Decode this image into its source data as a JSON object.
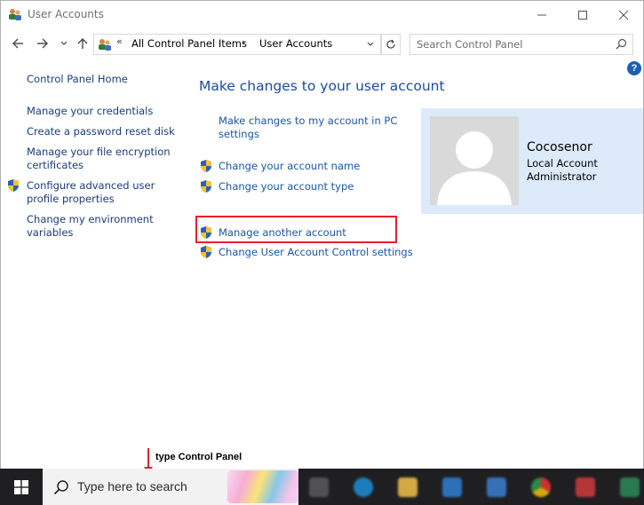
{
  "window": {
    "title": "User Accounts",
    "controls": [
      "minimize",
      "maximize",
      "close"
    ]
  },
  "address_bar": {
    "overflow": "«",
    "crumbs": [
      "All Control Panel Items",
      "User Accounts"
    ],
    "separator": "›"
  },
  "search": {
    "placeholder": "Search Control Panel"
  },
  "help_label": "?",
  "sidebar": {
    "items": [
      {
        "label": "Control Panel Home"
      },
      {
        "label": "Manage your credentials"
      },
      {
        "label": "Create a password reset disk"
      },
      {
        "label": "Manage your file encryption",
        "label2": "certificates"
      },
      {
        "label": "Configure advanced user",
        "label2": "profile properties",
        "icon": "uac-shield-icon"
      },
      {
        "label": "Change my environment",
        "label2": "variables"
      }
    ]
  },
  "main": {
    "heading": "Make changes to your user account",
    "links": [
      {
        "label": "Make changes to my account in PC",
        "label2": "settings"
      },
      {
        "label": "Change your account name",
        "icon": "uac-shield-icon"
      },
      {
        "label": "Change your account type",
        "icon": "uac-shield-icon"
      },
      {
        "label": "Manage another account",
        "icon": "uac-shield-icon",
        "highlighted": true
      },
      {
        "label": "Change User Account Control settings",
        "icon": "uac-shield-icon"
      }
    ]
  },
  "account": {
    "name": "Cocosenor",
    "type": "Local Account",
    "role": "Administrator"
  },
  "annotation": {
    "text": "type Control Panel"
  },
  "taskbar": {
    "search_placeholder": "Type here to search",
    "icons": [
      "start-icon",
      "task-view-icon",
      "edge-icon",
      "file-explorer-icon",
      "mail-icon",
      "store-icon",
      "chrome-icon",
      "app-icon"
    ]
  },
  "colors": {
    "link": "#1a3c7a",
    "heading": "#1e4aa6",
    "highlight": "#e8202a",
    "card": "#ddeaf9",
    "taskbar": "#1f1f22"
  }
}
